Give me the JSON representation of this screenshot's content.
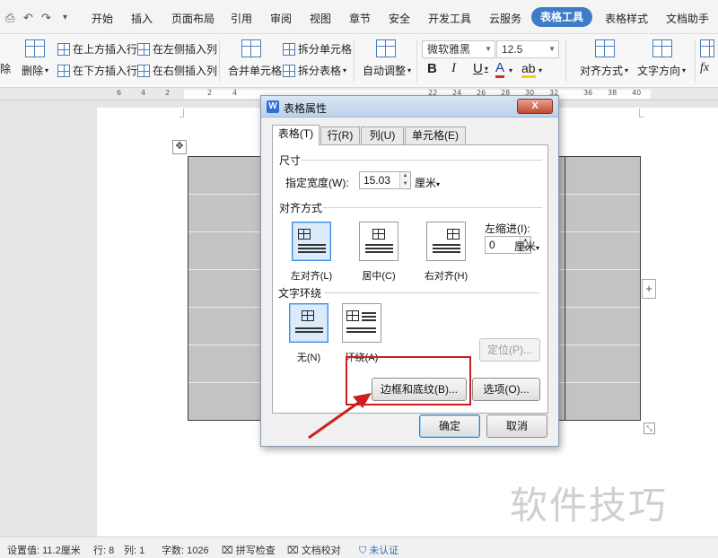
{
  "quick_access": {
    "icons": [
      "preview-icon",
      "undo-icon",
      "redo-icon",
      "more-icon"
    ]
  },
  "menu_tabs": [
    "开始",
    "插入",
    "页面布局",
    "引用",
    "审阅",
    "视图",
    "章节",
    "安全",
    "开发工具",
    "云服务",
    "表格工具",
    "表格样式",
    "文档助手"
  ],
  "active_menu_tab": "表格工具",
  "ribbon": {
    "delete_cut": "除",
    "delete": "删除",
    "insert_above": "在上方插入行",
    "insert_below": "在下方插入行",
    "insert_left": "在左侧插入列",
    "insert_right": "在右侧插入列",
    "merge_cells": "合并单元格",
    "split_cells": "拆分单元格",
    "split_table": "拆分表格",
    "auto_fit": "自动调整",
    "font_name": "微软雅黑",
    "font_size": "12.5",
    "bold": "B",
    "italic": "I",
    "underline": "U",
    "font_color": "A",
    "char_shading": "ab",
    "align": "对齐方式",
    "text_direction": "文字方向",
    "formula": "fx"
  },
  "ruler": {
    "numbers": [
      "6",
      "4",
      "2",
      "2",
      "4",
      "22",
      "24",
      "26",
      "28",
      "30",
      "32",
      "36",
      "38",
      "40"
    ]
  },
  "dialog": {
    "title": "表格属性",
    "close": "X",
    "tabs": [
      "表格(T)",
      "行(R)",
      "列(U)",
      "单元格(E)"
    ],
    "active_tab": "表格(T)",
    "size_group": "尺寸",
    "specify_width_label": "指定宽度(W):",
    "specify_width_value": "15.03",
    "width_unit": "厘米",
    "align_group": "对齐方式",
    "align_options": [
      "左对齐(L)",
      "居中(C)",
      "右对齐(H)"
    ],
    "selected_align": "左对齐(L)",
    "left_indent_label": "左缩进(I):",
    "left_indent_value": "0",
    "indent_unit": "厘米",
    "wrap_group": "文字环绕",
    "wrap_options": [
      "无(N)",
      "环绕(A)"
    ],
    "selected_wrap": "无(N)",
    "position_button": "定位(P)...",
    "borders_button": "边框和底纹(B)...",
    "options_button": "选项(O)...",
    "ok_button": "确定",
    "cancel_button": "取消"
  },
  "statusbar": {
    "setting_value": "设置值: 11.2厘米",
    "row": "行: 8",
    "col": "列: 1",
    "word_count": "字数: 1026",
    "spell_check": "拼写检查",
    "doc_proof": "文档校对",
    "unverified": "未认证"
  },
  "watermark": "软件技巧",
  "colors": {
    "active_tab": "#3d7cc8",
    "highlight": "#cc1f1f",
    "table_fill": "#c3c3c3",
    "selected_option": "#dcebfb"
  }
}
